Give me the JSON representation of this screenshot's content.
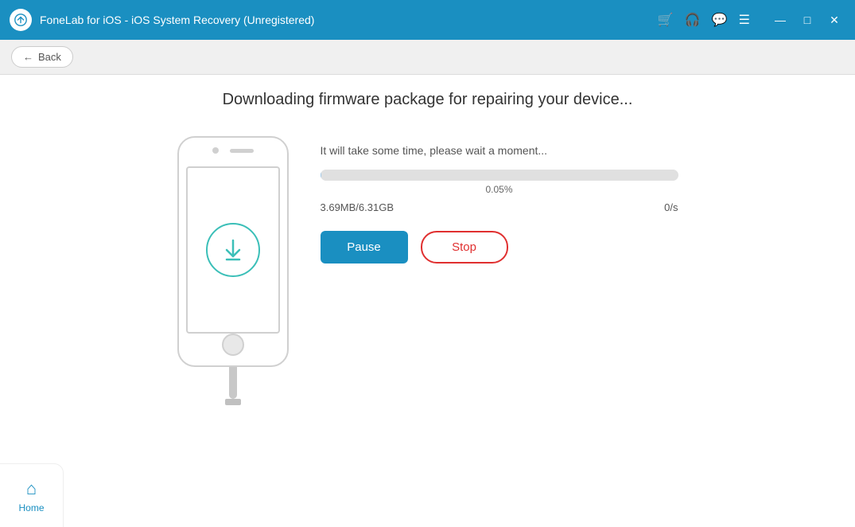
{
  "titlebar": {
    "title": "FoneLab for iOS - iOS System Recovery (Unregistered)",
    "icon": "gear-settings-icon"
  },
  "toolbar": {
    "back_label": "Back"
  },
  "main": {
    "page_title": "Downloading firmware package for repairing your device...",
    "wait_text": "It will take some time, please wait a moment...",
    "progress_percent": "0.05%",
    "progress_fill_width": "0.1%",
    "file_size": "3.69MB/6.31GB",
    "speed": "0/s",
    "pause_label": "Pause",
    "stop_label": "Stop"
  },
  "bottom_nav": {
    "home_label": "Home"
  },
  "icons": {
    "cart": "🛒",
    "headset": "🎧",
    "chat": "💬",
    "menu": "☰",
    "minimize": "—",
    "maximize": "□",
    "close": "✕",
    "back_arrow": "←",
    "download_arrow": "↓",
    "home": "⌂"
  }
}
